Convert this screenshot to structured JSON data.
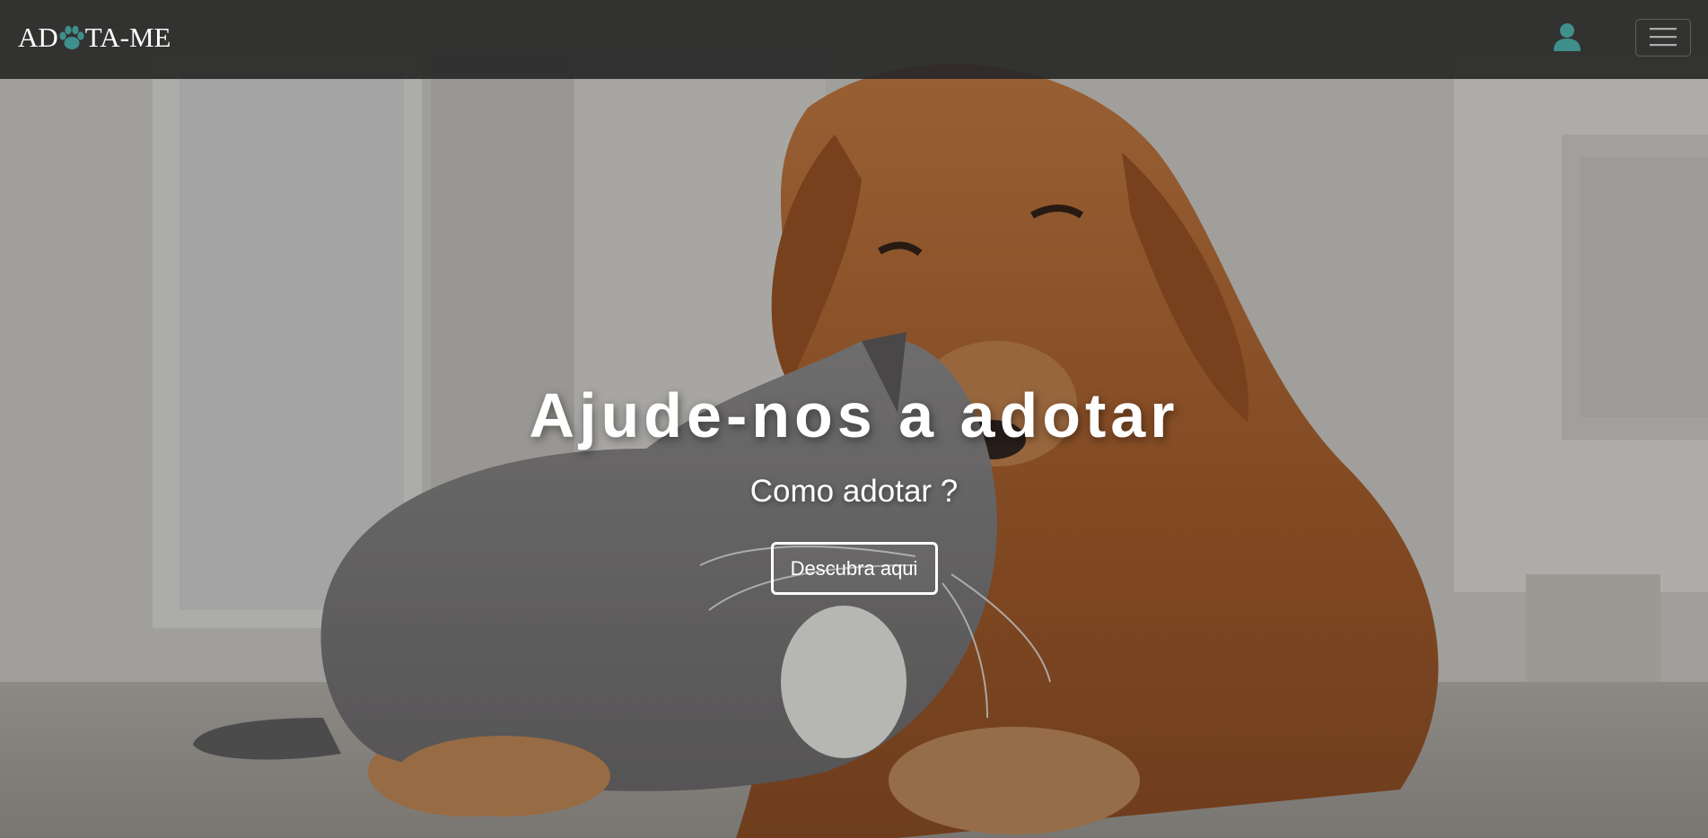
{
  "navbar": {
    "brand_prefix": "AD",
    "brand_suffix": "TA-ME",
    "brand_icon": "paw-icon",
    "user_icon": "user-icon",
    "menu_icon": "hamburger-icon"
  },
  "hero": {
    "title": "Ajude-nos a adotar",
    "subtitle": "Como adotar ?",
    "cta_label": "Descubra aqui",
    "background": "dog-and-cat-photo"
  },
  "colors": {
    "navbar_bg": "#282828",
    "accent": "#3f8f8b",
    "text": "#ffffff"
  }
}
